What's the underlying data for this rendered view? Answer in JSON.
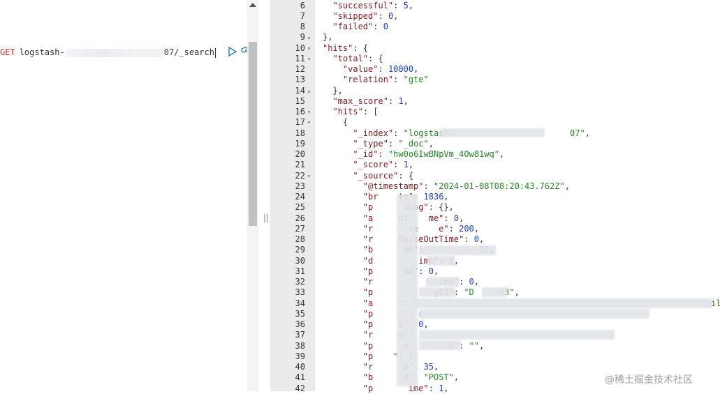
{
  "request": {
    "method": "GET",
    "path_start": "logstash-",
    "path_end": "07/_search"
  },
  "response_lines": [
    {
      "num": "6",
      "fold": "",
      "text": "  \"successful\": 5,"
    },
    {
      "num": "7",
      "fold": "",
      "text": "  \"skipped\": 0,"
    },
    {
      "num": "8",
      "fold": "",
      "text": "  \"failed\": 0"
    },
    {
      "num": "9",
      "fold": "▴",
      "text": "},"
    },
    {
      "num": "10",
      "fold": "▾",
      "text": "\"hits\": {"
    },
    {
      "num": "11",
      "fold": "▾",
      "text": "  \"total\": {"
    },
    {
      "num": "12",
      "fold": "",
      "text": "    \"value\": 10000,"
    },
    {
      "num": "13",
      "fold": "",
      "text": "    \"relation\": \"gte\""
    },
    {
      "num": "14",
      "fold": "▴",
      "text": "  },"
    },
    {
      "num": "15",
      "fold": "",
      "text": "  \"max_score\": 1,"
    },
    {
      "num": "16",
      "fold": "▾",
      "text": "  \"hits\": ["
    },
    {
      "num": "17",
      "fold": "▾",
      "text": "    {"
    },
    {
      "num": "18",
      "fold": "",
      "text": "      \"_index\": \"logstash-                       07\","
    },
    {
      "num": "19",
      "fold": "",
      "text": "      \"_type\": \"_doc\","
    },
    {
      "num": "20",
      "fold": "",
      "text": "      \"_id\": \"hw0o6IwBNpVm_4Ow81wq\","
    },
    {
      "num": "21",
      "fold": "",
      "text": "      \"_score\": 1,"
    },
    {
      "num": "22",
      "fold": "▾",
      "text": "      \"_source\": {"
    },
    {
      "num": "23",
      "fold": "",
      "text": "        \"@timestamp\": \"2024-01-08T08:20:43.762Z\","
    },
    {
      "num": "24",
      "fold": "",
      "text": "        \"br    te\": 1836,"
    },
    {
      "num": "25",
      "fold": "",
      "text": "        \"p      sLog\": {},"
    },
    {
      "num": "26",
      "fold": "",
      "text": "        \"a     ut    me\": 0,"
    },
    {
      "num": "27",
      "fold": "",
      "text": "        \"r       se    e\": 200,"
    },
    {
      "num": "28",
      "fold": "",
      "text": "        \"r     ParseOutTime\": 0,"
    },
    {
      "num": "29",
      "fold": "",
      "text": "        \"b      me\": \"          32,"
    },
    {
      "num": "30",
      "fold": "",
      "text": "        \"d         ime\": 1,"
    },
    {
      "num": "31",
      "fold": "",
      "text": "        \"p      me\": 0,"
    },
    {
      "num": "32",
      "fold": "",
      "text": "        \"r             ime\": 0,"
    },
    {
      "num": "33",
      "fold": "",
      "text": "        \"p            yId\": \"D     03\","
    },
    {
      "num": "34",
      "fold": "",
      "text": "        \"a     \": \""
    },
    {
      "num": "35",
      "fold": "",
      "text": "        \"p      \": \"c"
    },
    {
      "num": "36",
      "fold": "",
      "text": "        \"p     e\": 0,"
    },
    {
      "num": "37",
      "fold": "",
      "text": "        \"r     a\": \""
    },
    {
      "num": "38",
      "fold": "",
      "text": "        \"p      n        d\": \"\","
    },
    {
      "num": "39",
      "fold": "",
      "text": "        \"p    \": 1,"
    },
    {
      "num": "40",
      "fold": "",
      "text": "        \"r      e\": 35,"
    },
    {
      "num": "41",
      "fold": "",
      "text": "        \"b      d\": \"POST\","
    },
    {
      "num": "42",
      "fold": "",
      "text": "        \"p       ime\": 1,"
    }
  ],
  "line34_tail": "il",
  "watermark": "@稀土掘金技术社区",
  "icons": [
    "run-icon",
    "wrench-icon",
    "scroll-up-icon",
    "splitter-grip-icon",
    "fold-toggle-icon"
  ],
  "colors": {
    "method": "#c52a2a",
    "key": "#7a1e1e",
    "string": "#2a7f2a",
    "number": "#1f3fbf",
    "gutter": "#ebebeb",
    "scrollbar_thumb": "#c1c1c1"
  }
}
